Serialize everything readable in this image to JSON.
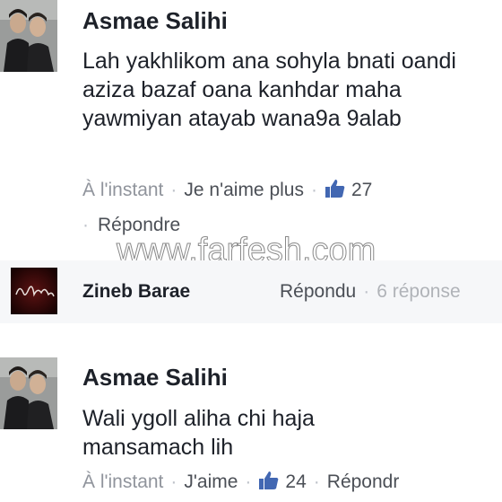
{
  "comments": [
    {
      "author": "Asmae Salihi",
      "text": "Lah yakhlikom ana sohyla bnati oandi aziza bazaf oana kanhdar maha yawmiyan atayab wana9a 9alab",
      "time": "À l'instant",
      "action": "Je n'aime plus",
      "likes": "27",
      "reply": "Répondre"
    },
    {
      "author": "Asmae Salihi",
      "text": "Wali ygoll aliha chi haja mansamach lih",
      "time": "À l'instant",
      "action": "J'aime",
      "likes": "24",
      "reply": "Répondr"
    }
  ],
  "reply_row": {
    "author": "Zineb Barae",
    "status": "Répondu",
    "count": "6 réponse"
  },
  "watermark": "www.farfesh.com",
  "colors": {
    "name": "#1d2129",
    "meta": "#90949c",
    "link": "#4b4f56",
    "thumb": "#4267b2",
    "band": "#f6f7f9"
  }
}
